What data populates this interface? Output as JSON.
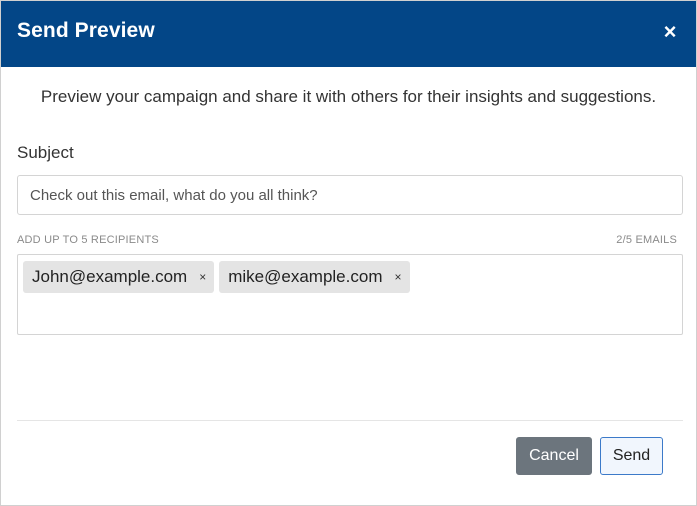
{
  "dialog": {
    "title": "Send Preview",
    "close_icon": "close-icon",
    "close_glyph": "×"
  },
  "intro_text": "Preview your campaign and share it with others for their insights and suggestions.",
  "subject": {
    "label": "Subject",
    "value": "Check out this email, what do you all think?"
  },
  "recipients": {
    "label": "ADD UP TO 5 RECIPIENTS",
    "count": "2/5 EMAILS",
    "chips": [
      {
        "email": "John@example.com",
        "remove": "×"
      },
      {
        "email": "mike@example.com",
        "remove": "×"
      }
    ]
  },
  "footer": {
    "cancel_label": "Cancel",
    "send_label": "Send"
  },
  "colors": {
    "header_bg": "#034687",
    "cancel_bg": "#6c757d",
    "send_border": "#3c7ac9"
  }
}
